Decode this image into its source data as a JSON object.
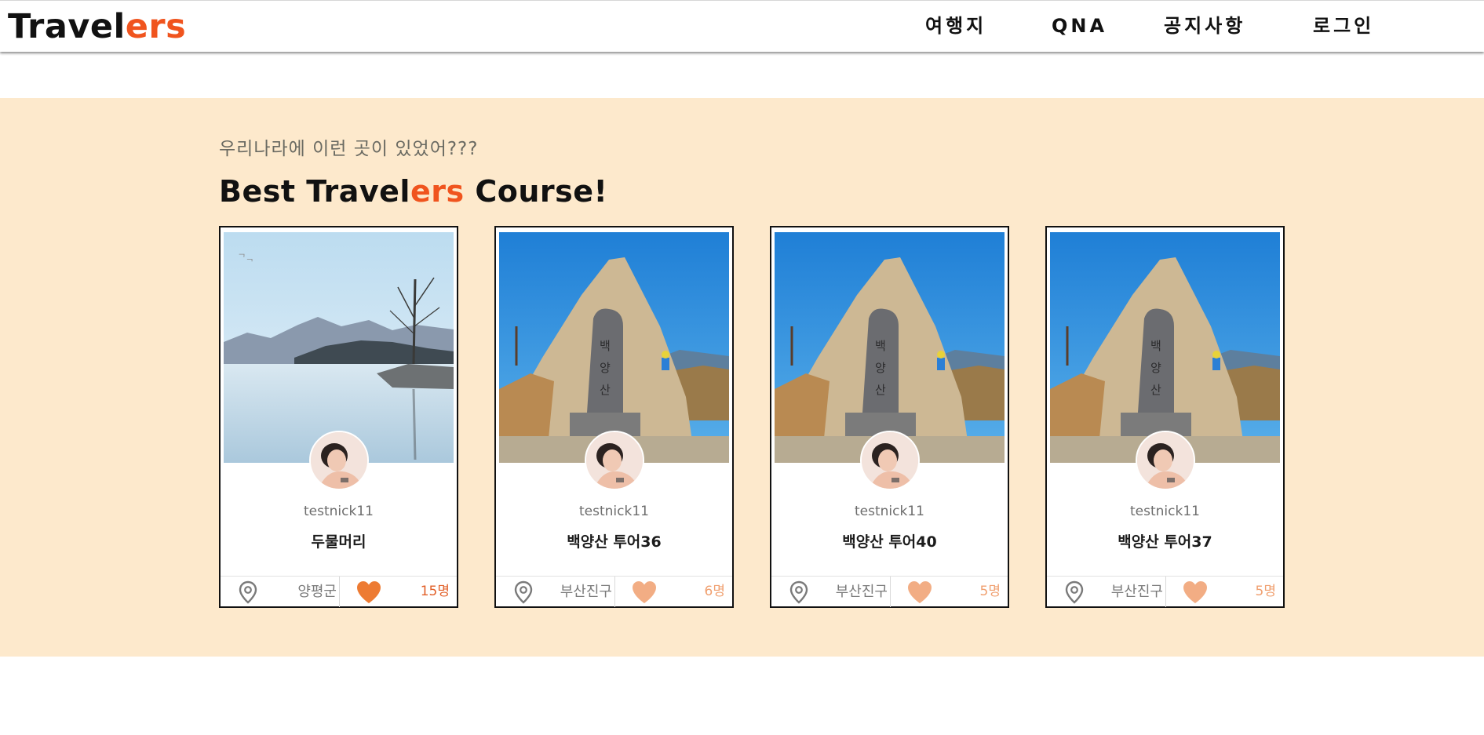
{
  "header": {
    "logo_main": "Travel",
    "logo_accent": "ers",
    "nav": [
      "여행지",
      "QNA",
      "공지사항",
      "로그인"
    ]
  },
  "section": {
    "subtitle": "우리나라에 이런 곳이 있었어???",
    "title_prefix": "Best Travel",
    "title_accent": "ers",
    "title_suffix": " Course!"
  },
  "colors": {
    "accent": "#f0541e",
    "section_bg": "#fde9cc",
    "heart_active": "#ed7b33",
    "heart_inactive": "#f2ad84"
  },
  "cards": [
    {
      "nickname": "testnick11",
      "course_name": "두물머리",
      "location": "양평군",
      "likes": "15명",
      "liked": true,
      "image": "lake-photo",
      "avatar": "user-avatar",
      "location_icon": "map-pin-icon",
      "like_icon": "heart-icon"
    },
    {
      "nickname": "testnick11",
      "course_name": "백양산 투어36",
      "location": "부산진구",
      "likes": "6명",
      "liked": false,
      "image": "mountain-summit-photo",
      "avatar": "user-avatar",
      "location_icon": "map-pin-icon",
      "like_icon": "heart-icon"
    },
    {
      "nickname": "testnick11",
      "course_name": "백양산 투어40",
      "location": "부산진구",
      "likes": "5명",
      "liked": false,
      "image": "mountain-summit-photo",
      "avatar": "user-avatar",
      "location_icon": "map-pin-icon",
      "like_icon": "heart-icon"
    },
    {
      "nickname": "testnick11",
      "course_name": "백양산 투어37",
      "location": "부산진구",
      "likes": "5명",
      "liked": false,
      "image": "mountain-summit-photo",
      "avatar": "user-avatar",
      "location_icon": "map-pin-icon",
      "like_icon": "heart-icon"
    }
  ]
}
